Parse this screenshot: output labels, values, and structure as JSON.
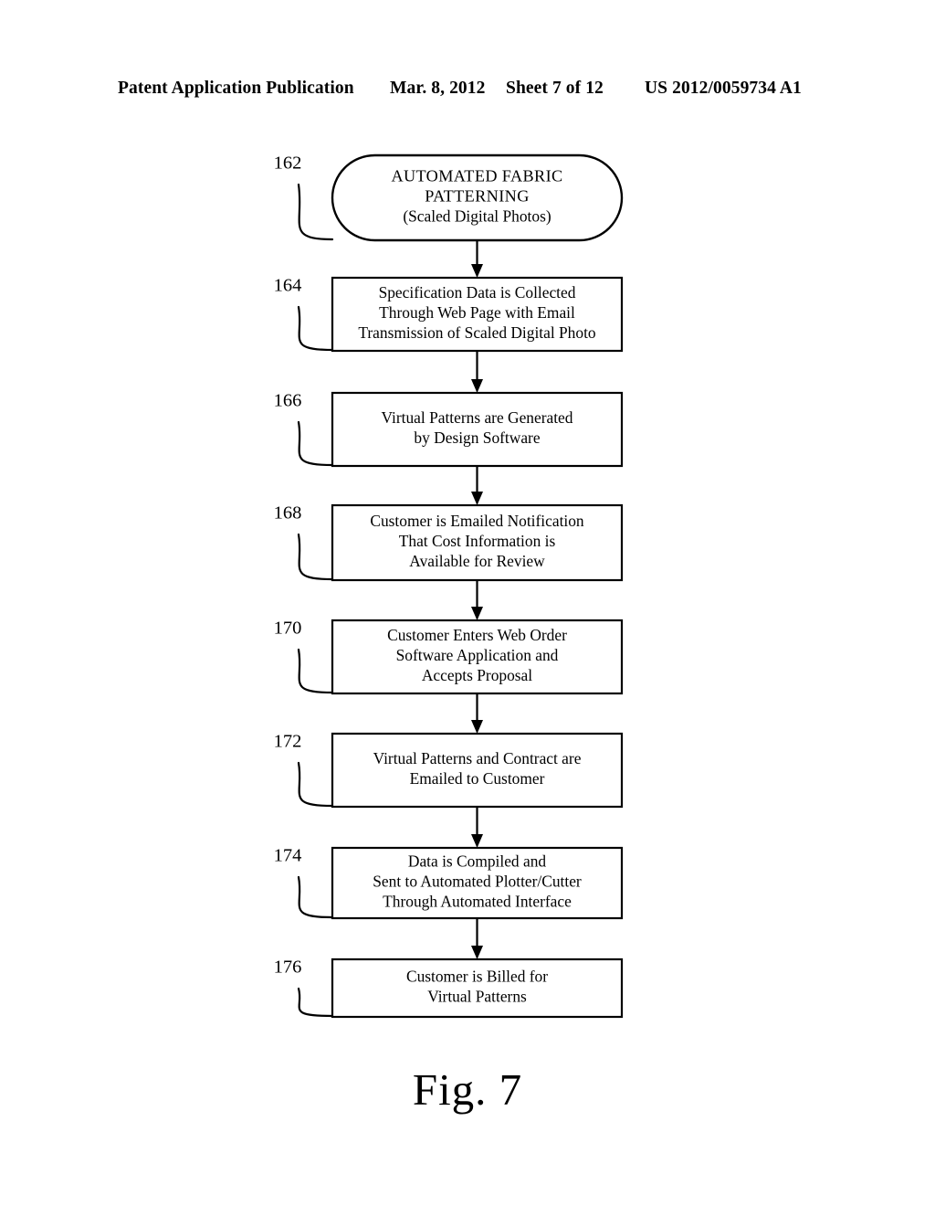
{
  "header": {
    "publication": "Patent Application Publication",
    "date": "Mar. 8, 2012",
    "sheet": "Sheet 7 of 12",
    "publication_number": "US 2012/0059734 A1"
  },
  "figure": {
    "caption": "Fig. 7"
  },
  "flowchart": {
    "nodes": [
      {
        "ref": "162",
        "shape": "terminal",
        "lines": [
          "AUTOMATED FABRIC",
          "PATTERNING",
          "(Scaled Digital Photos)"
        ]
      },
      {
        "ref": "164",
        "shape": "process",
        "lines": [
          "Specification Data is Collected",
          "Through Web Page with Email",
          "Transmission of Scaled Digital Photo"
        ]
      },
      {
        "ref": "166",
        "shape": "process",
        "lines": [
          "Virtual Patterns are Generated",
          "by Design Software"
        ]
      },
      {
        "ref": "168",
        "shape": "process",
        "lines": [
          "Customer is Emailed Notification",
          "That Cost Information is",
          "Available for Review"
        ]
      },
      {
        "ref": "170",
        "shape": "process",
        "lines": [
          "Customer Enters Web Order",
          "Software Application and",
          "Accepts Proposal"
        ]
      },
      {
        "ref": "172",
        "shape": "process",
        "lines": [
          "Virtual Patterns and Contract are",
          "Emailed to Customer"
        ]
      },
      {
        "ref": "174",
        "shape": "process",
        "lines": [
          "Data is Compiled and",
          "Sent to Automated Plotter/Cutter",
          "Through Automated Interface"
        ]
      },
      {
        "ref": "176",
        "shape": "process",
        "lines": [
          "Customer is Billed for",
          "Virtual Patterns"
        ]
      }
    ],
    "connector_count": 7,
    "colors": {
      "ink": "#000000",
      "paper": "#ffffff"
    }
  }
}
